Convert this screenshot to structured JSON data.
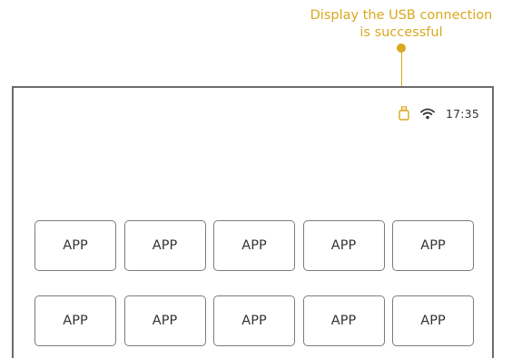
{
  "callout": {
    "line1": "Display the USB connection",
    "line2": "is successful",
    "color": "#d9a81e"
  },
  "status_bar": {
    "icons": [
      "usb-icon",
      "wifi-icon"
    ],
    "time": "17:35"
  },
  "apps": {
    "row1": [
      "APP",
      "APP",
      "APP",
      "APP",
      "APP"
    ],
    "row2": [
      "APP",
      "APP",
      "APP",
      "APP",
      "APP"
    ]
  }
}
